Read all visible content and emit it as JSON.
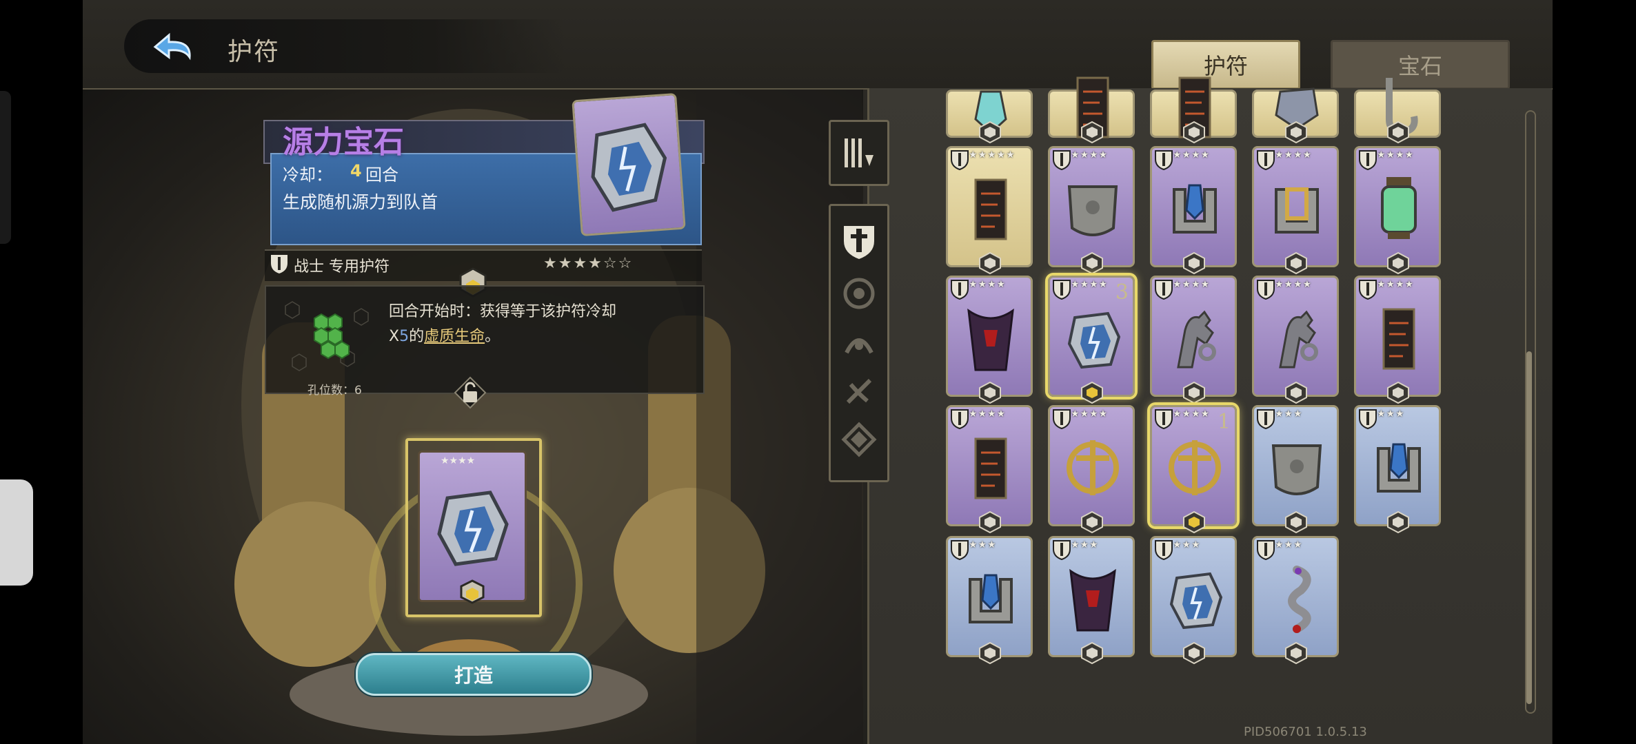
{
  "header": {
    "title": "护符",
    "tabs": [
      {
        "label": "护符",
        "active": true
      },
      {
        "label": "宝石",
        "active": false
      }
    ]
  },
  "detail": {
    "name": "源力宝石",
    "cooldown_label": "冷却：",
    "cooldown_value": "4",
    "cooldown_unit": "回合",
    "description": "生成随机源力到队首",
    "class_line": "战士 专用护符",
    "rating_stars": 6,
    "rating_filled": 4,
    "effect_line1": "回合开始时：获得等于该护符冷却",
    "effect_x": "X",
    "effect_multiplier": "5",
    "effect_mid": "的",
    "effect_link": "虚质生命",
    "effect_end": "。",
    "slots_label": "孔位数：6"
  },
  "forge": {
    "button_label": "打造"
  },
  "footer": {
    "pid": "PID506701  1.0.5.13"
  },
  "colors": {
    "title_purple": "#b77fe6",
    "accent_gold": "#e8d86a",
    "forge_teal": "#3e9aa8"
  },
  "sidebar_icons": [
    "filter-icon",
    "warrior-class-icon",
    "beast-class-icon",
    "mage-class-icon",
    "rogue-class-icon",
    "rune-class-icon"
  ],
  "grid": {
    "rows": [
      [
        {
          "item": "crystal-charm",
          "bg": "yellow",
          "pips": "",
          "number": ""
        },
        {
          "item": "banner-charm",
          "bg": "yellow",
          "pips": "",
          "number": ""
        },
        {
          "item": "banner-charm",
          "bg": "yellow",
          "pips": "",
          "number": ""
        },
        {
          "item": "stone-charm",
          "bg": "yellow",
          "pips": "",
          "number": ""
        },
        {
          "item": "hook-charm",
          "bg": "yellow",
          "pips": "",
          "number": ""
        }
      ],
      [
        {
          "item": "banner-charm",
          "bg": "yellow",
          "pips": "★★★★★",
          "number": ""
        },
        {
          "item": "stone-shield-charm",
          "bg": "purple",
          "pips": "★★★★",
          "number": ""
        },
        {
          "item": "blue-gem-bracket",
          "bg": "purple",
          "pips": "★★★★",
          "number": ""
        },
        {
          "item": "gold-gem-bracket",
          "bg": "purple",
          "pips": "★★★★",
          "number": ""
        },
        {
          "item": "green-lantern",
          "bg": "purple",
          "pips": "★★★★",
          "number": ""
        }
      ],
      [
        {
          "item": "cloak-charm",
          "bg": "purple",
          "pips": "★★★★",
          "number": ""
        },
        {
          "item": "source-gem",
          "bg": "purple",
          "pips": "★★★★",
          "number": "3",
          "selected": true
        },
        {
          "item": "claw-charm",
          "bg": "purple",
          "pips": "★★★★",
          "number": ""
        },
        {
          "item": "claw-charm",
          "bg": "purple",
          "pips": "★★★★",
          "number": ""
        },
        {
          "item": "banner-charm",
          "bg": "purple",
          "pips": "★★★★",
          "number": ""
        }
      ],
      [
        {
          "item": "banner-charm",
          "bg": "purple",
          "pips": "★★★★",
          "number": ""
        },
        {
          "item": "gold-anchor",
          "bg": "purple",
          "pips": "★★★★",
          "number": ""
        },
        {
          "item": "gold-anchor",
          "bg": "purple",
          "pips": "★★★★",
          "number": "1",
          "selected": true
        },
        {
          "item": "stone-shield-charm",
          "bg": "blue",
          "pips": "★★★",
          "number": ""
        },
        {
          "item": "blue-gem-bracket",
          "bg": "blue",
          "pips": "★★★",
          "number": ""
        }
      ],
      [
        {
          "item": "blue-gem-bracket",
          "bg": "blue",
          "pips": "★★★",
          "number": ""
        },
        {
          "item": "cloak-charm",
          "bg": "blue",
          "pips": "★★★",
          "number": ""
        },
        {
          "item": "source-gem",
          "bg": "blue",
          "pips": "★★★",
          "number": ""
        },
        {
          "item": "serpent-charm",
          "bg": "blue",
          "pips": "★★★",
          "number": ""
        }
      ]
    ]
  }
}
